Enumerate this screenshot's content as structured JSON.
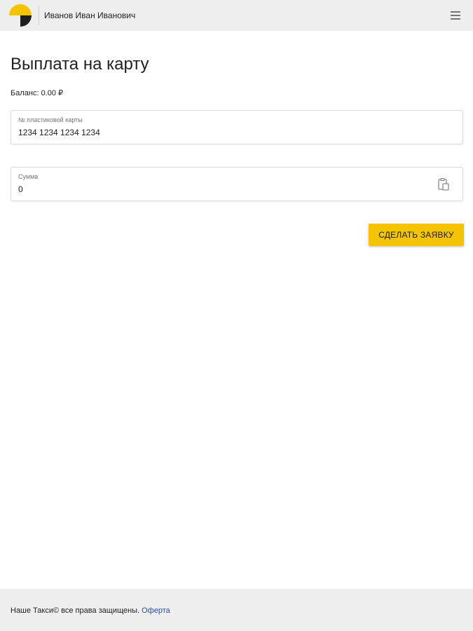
{
  "header": {
    "user_name": "Иванов Иван Иванович",
    "logo_icon": "taxi-logo-icon",
    "menu_icon": "hamburger-menu-icon"
  },
  "main": {
    "title": "Выплата на карту",
    "balance_label": "Баланс:",
    "balance_value": "0.00 ₽",
    "card_field": {
      "label": "№ пластиковой карты",
      "value": "1234 1234 1234 1234"
    },
    "amount_field": {
      "label": "Сумма",
      "value": "0",
      "icon": "paste-icon"
    },
    "submit_label": "СДЕЛАТЬ ЗАЯВКУ"
  },
  "footer": {
    "text": "Наше Такси© все права защищены.",
    "link_label": "Оферта"
  },
  "colors": {
    "accent": "#f5c400",
    "header_bg": "#eeeeee",
    "link": "#2b4fa0"
  }
}
